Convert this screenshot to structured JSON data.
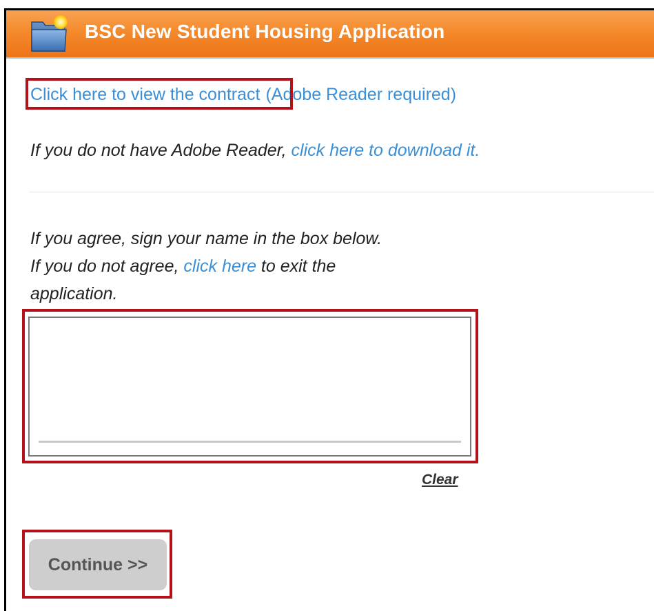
{
  "header": {
    "title": "BSC New Student Housing Application",
    "icon": "folder-icon"
  },
  "contract": {
    "link_label": "Click here to view the contract",
    "note": "(Adobe Reader required)"
  },
  "reader": {
    "prefix": "If you do not have Adobe Reader, ",
    "link_label": "click here to download it",
    "suffix": "."
  },
  "agreement": {
    "line1": "If you agree, sign your name in the box below.",
    "line2_prefix": "If you do not agree, ",
    "line2_link": "click here",
    "line2_suffix": " to exit the",
    "line3": "application."
  },
  "signature": {
    "clear_label": "Clear"
  },
  "actions": {
    "continue_label": "Continue >>"
  },
  "colors": {
    "header_orange": "#f48a2c",
    "link_blue": "#3a8fd6",
    "highlight_red": "#b3121b",
    "button_gray": "#cecece"
  }
}
